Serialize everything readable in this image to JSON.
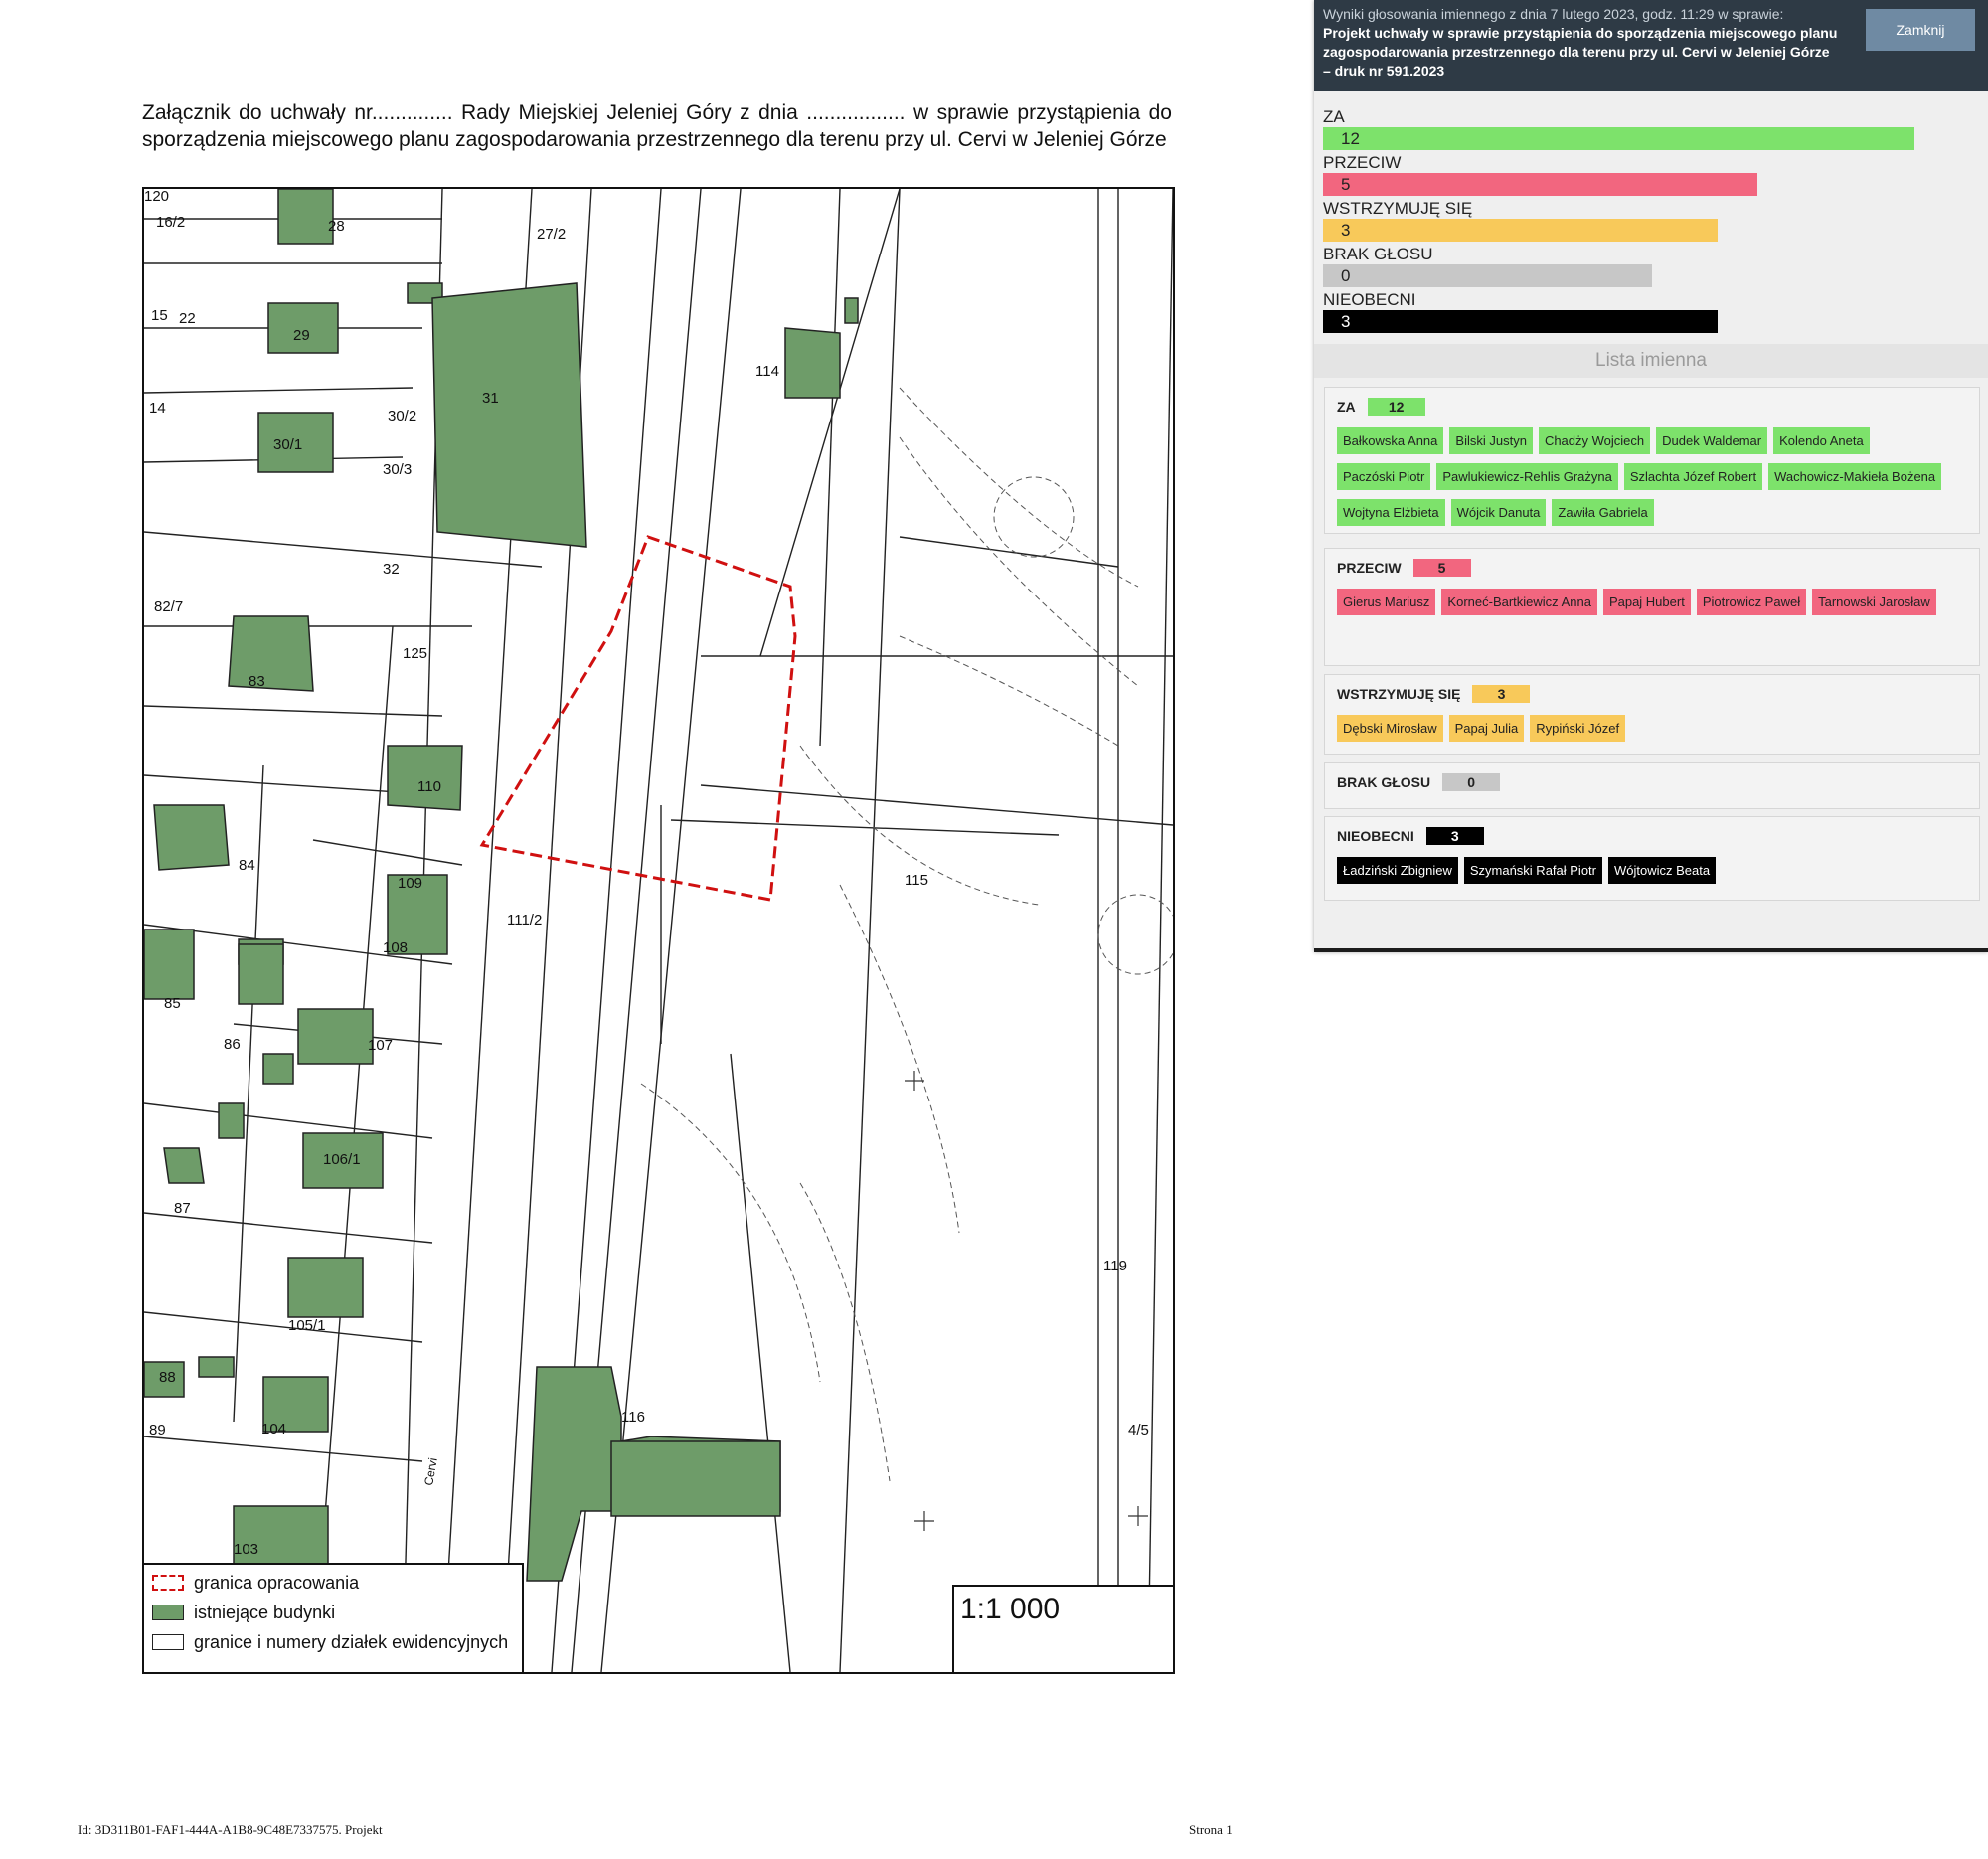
{
  "document": {
    "title": "Załącznik do uchwały nr.............. Rady Miejskiej Jeleniej Góry z dnia ................. w sprawie przystąpienia do sporządzenia miejscowego planu zagospodarowania przestrzennego dla terenu przy ul. Cervi w Jeleniej Górze",
    "map_labels": [
      "120",
      "16/2",
      "28",
      "27/2",
      "15",
      "22",
      "29",
      "14",
      "114",
      "31",
      "30/2",
      "30/1",
      "30/3",
      "32",
      "82/7",
      "125",
      "83",
      "110",
      "84",
      "115",
      "109",
      "111/2",
      "108",
      "85",
      "86",
      "107",
      "106/1",
      "87",
      "119",
      "105/1",
      "88",
      "89",
      "104",
      "116",
      "4/5",
      "103",
      "Cervi"
    ],
    "legend": {
      "boundary": "granica opracowania",
      "buildings": "istniejące budynki",
      "parcels": "granice i numery działek ewidencyjnych"
    },
    "scale": "1:1 000",
    "footer_id": "Id: 3D311B01-FAF1-444A-A1B8-9C48E7337575. Projekt",
    "footer_page": "Strona 1"
  },
  "panel": {
    "header_pre": "Wyniki głosowania imiennego z dnia 7 lutego 2023, godz. 11:29 w sprawie:",
    "subject": "Projekt uchwały w sprawie przystąpienia do sporządzenia miejscowego planu zagospodarowania przestrzennego dla terenu przy ul. Cervi w Jeleniej Górze – druk nr 591.2023",
    "close_label": "Zamknij",
    "bars": [
      {
        "label": "ZA",
        "value": "12",
        "fraction": 1.0,
        "color": "#7de26b"
      },
      {
        "label": "PRZECIW",
        "value": "5",
        "fraction": 0.734,
        "color": "#f2667f"
      },
      {
        "label": "WSTRZYMUJĘ SIĘ",
        "value": "3",
        "fraction": 0.668,
        "color": "#f8c95a"
      },
      {
        "label": "BRAK GŁOSU",
        "value": "0",
        "fraction": 0.556,
        "color": "#c7c7c7"
      },
      {
        "label": "NIEOBECNI",
        "value": "3",
        "fraction": 0.668,
        "color": "#000000",
        "text_color": "#ffffff"
      }
    ],
    "names_title": "Lista imienna",
    "groups": [
      {
        "label": "ZA",
        "count": "12",
        "color": "#7de26b",
        "text_color": "#222222",
        "names": [
          "Bałkowska Anna",
          "Bilski Justyn",
          "Chadży Wojciech",
          "Dudek Waldemar",
          "Kolendo Aneta",
          "Paczóski Piotr",
          "Pawlukiewicz-Rehlis Grażyna",
          "Szlachta Józef Robert",
          "Wachowicz-Makieła Bożena",
          "Wojtyna Elżbieta",
          "Wójcik Danuta",
          "Zawiła Gabriela"
        ]
      },
      {
        "label": "PRZECIW",
        "count": "5",
        "color": "#f2667f",
        "text_color": "#222222",
        "names": [
          "Gierus Mariusz",
          "Korneć-Bartkiewicz Anna",
          "Papaj Hubert",
          "Piotrowicz Paweł",
          "Tarnowski Jarosław"
        ]
      },
      {
        "label": "WSTRZYMUJĘ SIĘ",
        "count": "3",
        "color": "#f8c95a",
        "text_color": "#222222",
        "names": [
          "Dębski Mirosław",
          "Papaj Julia",
          "Rypiński Józef"
        ]
      },
      {
        "label": "BRAK GŁOSU",
        "count": "0",
        "color": "#c7c7c7",
        "text_color": "#222222",
        "names": []
      },
      {
        "label": "NIEOBECNI",
        "count": "3",
        "color": "#000000",
        "text_color": "#ffffff",
        "names": [
          "Ładziński Zbigniew",
          "Szymański Rafał Piotr",
          "Wójtowicz Beata"
        ]
      }
    ]
  }
}
